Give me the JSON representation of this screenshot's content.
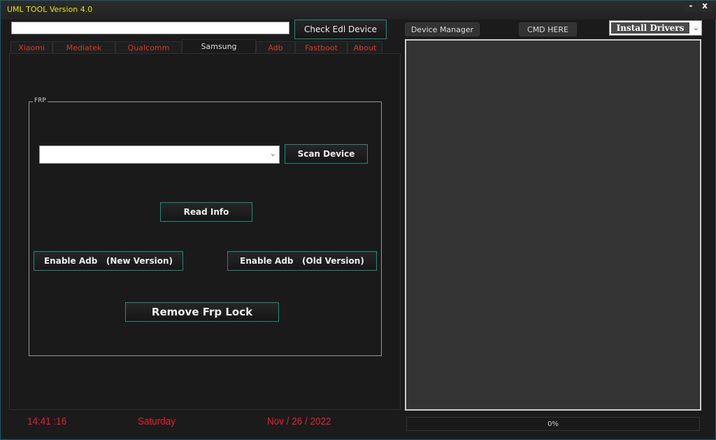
{
  "window": {
    "title": "UML TOOL Version 4.0",
    "minimize": "-",
    "close": "x"
  },
  "top": {
    "path_value": "",
    "check_edl": "Check Edl Device",
    "device_manager": "Device Manager",
    "cmd_here": "CMD HERE",
    "install_drivers": "Install Drivers"
  },
  "tabs": [
    {
      "label": "Xiaomi"
    },
    {
      "label": "Mediatek"
    },
    {
      "label": "Qualcomm"
    },
    {
      "label": "Samsung",
      "active": true
    },
    {
      "label": "Adb"
    },
    {
      "label": "Fastboot"
    },
    {
      "label": "About"
    }
  ],
  "frp": {
    "group_label": "FRP",
    "device_select": "",
    "scan_device": "Scan Device",
    "read_info": "Read Info",
    "enable_adb_new": "Enable Adb   (New Version)",
    "enable_adb_old": "Enable Adb   (Old Version)",
    "remove_frp": "Remove Frp Lock"
  },
  "status": {
    "time": "14:41 :16",
    "day": "Saturday",
    "date": "Nov / 26 / 2022",
    "progress_percent": 0,
    "progress_label": "0%"
  },
  "colors": {
    "title": "#e6e600",
    "tab_text": "#d43a2a",
    "footer_text": "#e0203a",
    "button_border": "#1f8a78"
  }
}
